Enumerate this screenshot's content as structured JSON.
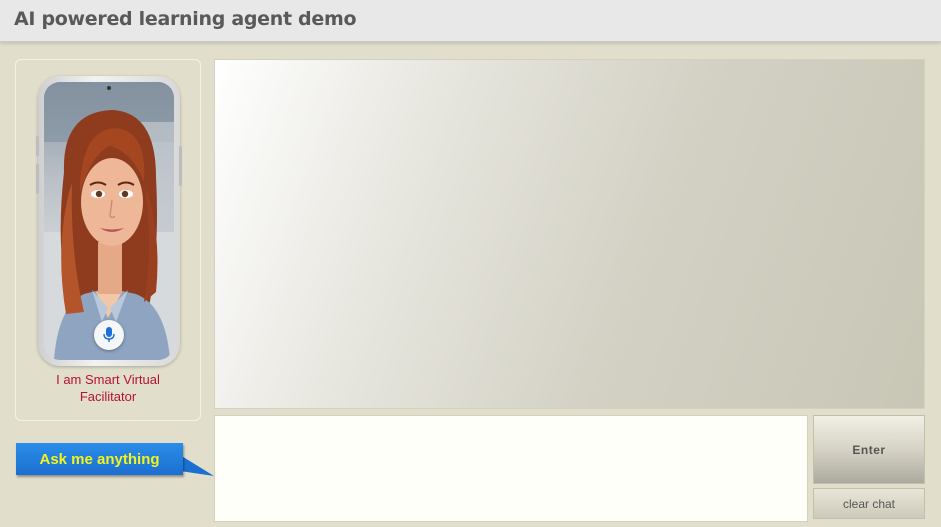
{
  "header": {
    "title": "AI powered learning agent demo"
  },
  "avatar": {
    "caption_line1": "I am Smart Virtual",
    "caption_line2": "Facilitator",
    "mic_icon": "microphone-icon"
  },
  "prompt": {
    "callout_label": "Ask me anything"
  },
  "chat": {
    "input_value": "",
    "input_placeholder": "",
    "enter_label": "Enter",
    "clear_label": "clear chat"
  },
  "colors": {
    "background": "#e1decb",
    "header": "#e8e8e8",
    "caption_text": "#b5123a",
    "callout_bg": "#1b6fd0",
    "callout_text": "#f6f21c"
  }
}
